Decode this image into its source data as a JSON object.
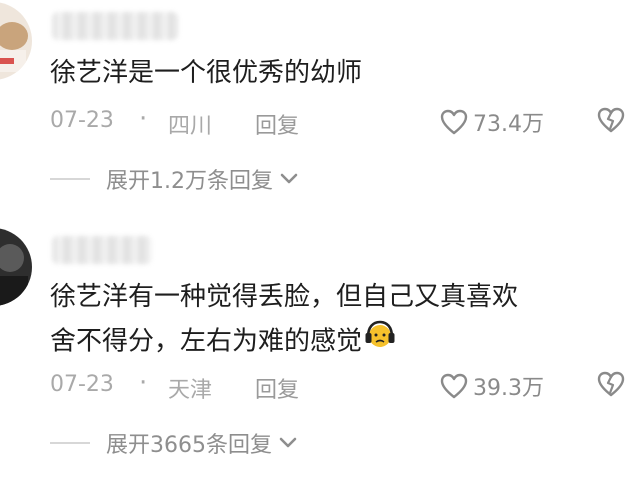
{
  "comments": [
    {
      "text": "徐艺洋是一个很优秀的幼师",
      "date": "07-23",
      "separator": "·",
      "location": "四川",
      "reply_label": "回复",
      "likes": "73.4万",
      "expand_label": "展开1.2万条回复"
    },
    {
      "text_line1": "徐艺洋有一种觉得丢脸，但自己又真喜欢",
      "text_line2": "舍不得分，左右为难的感觉",
      "date": "07-23",
      "separator": "·",
      "location": "天津",
      "reply_label": "回复",
      "likes": "39.3万",
      "expand_label": "展开3665条回复"
    }
  ],
  "colors": {
    "text": "#1e1e1e",
    "meta": "#a9a9a9",
    "icon": "#8a8a8a",
    "divider": "#d7d7d7"
  },
  "icons": {
    "like": "heart-outline-icon",
    "dislike": "broken-heart-icon",
    "expand": "chevron-down-icon",
    "emoji": "headphones-face-emoji"
  }
}
